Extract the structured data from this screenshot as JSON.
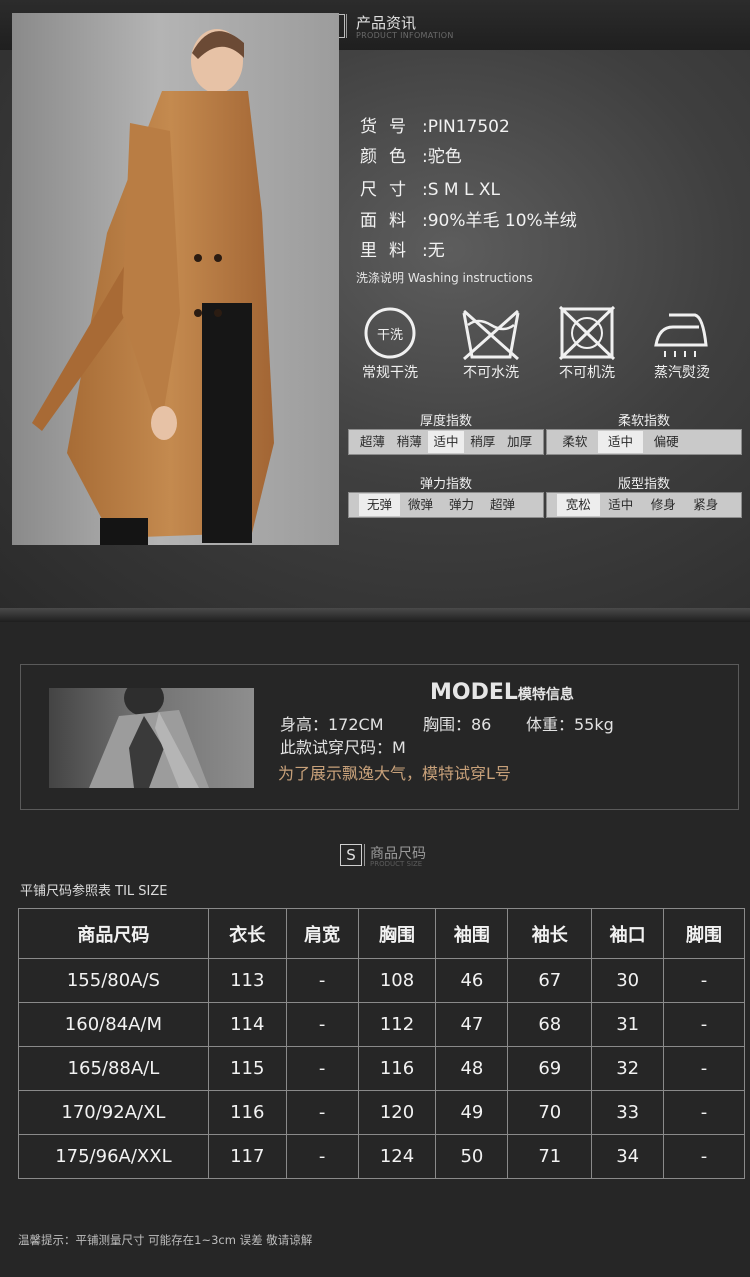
{
  "header": {
    "icon_text": "i",
    "title": "产品资讯",
    "subtitle": "PRODUCT INFOMATION"
  },
  "specs": [
    {
      "label": "货号",
      "value": ":PIN17502"
    },
    {
      "label": "颜色",
      "value": ":驼色"
    },
    {
      "label": "尺寸",
      "value": ":S M L XL"
    },
    {
      "label": "面料",
      "value": ":90%羊毛 10%羊绒"
    },
    {
      "label": "里料",
      "value": ":无"
    }
  ],
  "washing": {
    "title": "洗涤说明 Washing instructions",
    "icons": [
      {
        "icon": "dry-clean-icon",
        "inner_text": "干洗",
        "label": "常规干洗"
      },
      {
        "icon": "no-water-wash-icon",
        "label": "不可水洗"
      },
      {
        "icon": "no-machine-wash-icon",
        "label": "不可机洗"
      },
      {
        "icon": "steam-iron-icon",
        "label": "蒸汽熨烫"
      }
    ]
  },
  "indices": {
    "thickness": {
      "title": "厚度指数",
      "options": [
        "超薄",
        "稍薄",
        "适中",
        "稍厚",
        "加厚"
      ],
      "selected": 2
    },
    "softness": {
      "title": "柔软指数",
      "options": [
        "柔软",
        "适中",
        "偏硬"
      ],
      "selected": 1
    },
    "elasticity": {
      "title": "弹力指数",
      "options": [
        "无弹",
        "微弹",
        "弹力",
        "超弹"
      ],
      "selected": 0
    },
    "fit": {
      "title": "版型指数",
      "options": [
        "宽松",
        "适中",
        "修身",
        "紧身"
      ],
      "selected": 0
    }
  },
  "model": {
    "title": "MODEL",
    "title_cn": "模特信息",
    "height": "身高：172CM",
    "bust": "胸围：86",
    "weight": "体重：55kg",
    "size_tried": "此款试穿尺码：M",
    "note": "为了展示飘逸大气，模特试穿L号"
  },
  "size_section": {
    "icon_text": "S",
    "title": "商品尺码",
    "subtitle": "PRODUCT SIZE",
    "caption": "平铺尺码参照表 TIL SIZE",
    "columns": [
      "商品尺码",
      "衣长",
      "肩宽",
      "胸围",
      "袖围",
      "袖长",
      "袖口",
      "脚围"
    ],
    "rows": [
      [
        "155/80A/S",
        "113",
        "-",
        "108",
        "46",
        "67",
        "30",
        "-"
      ],
      [
        "160/84A/M",
        "114",
        "-",
        "112",
        "47",
        "68",
        "31",
        "-"
      ],
      [
        "165/88A/L",
        "115",
        "-",
        "116",
        "48",
        "69",
        "32",
        "-"
      ],
      [
        "170/92A/XL",
        "116",
        "-",
        "120",
        "49",
        "70",
        "33",
        "-"
      ],
      [
        "175/96A/XXL",
        "117",
        "-",
        "124",
        "50",
        "71",
        "34",
        "-"
      ]
    ]
  },
  "footer": {
    "tip": "温馨提示：平铺测量尺寸 可能存在1~3cm 误差 敬请谅解"
  }
}
